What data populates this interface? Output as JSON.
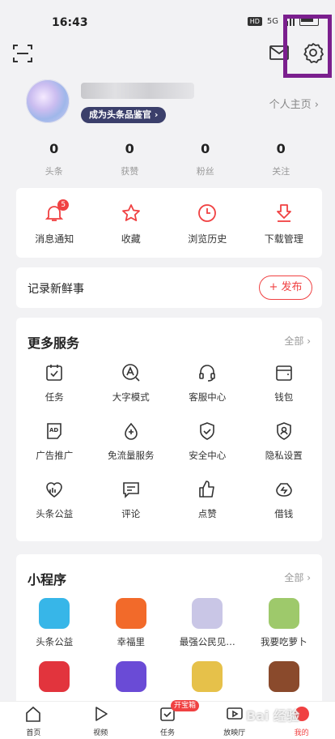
{
  "status": {
    "time": "16:43",
    "network": "5G",
    "hd": "HD"
  },
  "profile": {
    "badge": "成为头条品鉴官 ›",
    "home_link": "个人主页 ›"
  },
  "stats": [
    {
      "num": "0",
      "label": "头条"
    },
    {
      "num": "0",
      "label": "获赞"
    },
    {
      "num": "0",
      "label": "粉丝"
    },
    {
      "num": "0",
      "label": "关注"
    }
  ],
  "quick": [
    {
      "label": "消息通知",
      "icon": "bell-icon",
      "badge": "5"
    },
    {
      "label": "收藏",
      "icon": "star-icon"
    },
    {
      "label": "浏览历史",
      "icon": "clock-icon"
    },
    {
      "label": "下载管理",
      "icon": "download-icon"
    }
  ],
  "post": {
    "title": "记录新鲜事",
    "button": "+ 发布"
  },
  "services": {
    "title": "更多服务",
    "all": "全部 ›",
    "items": [
      {
        "label": "任务",
        "icon": "task-icon"
      },
      {
        "label": "大字模式",
        "icon": "big-font-icon"
      },
      {
        "label": "客服中心",
        "icon": "headset-icon"
      },
      {
        "label": "钱包",
        "icon": "wallet-icon"
      },
      {
        "label": "广告推广",
        "icon": "ad-icon"
      },
      {
        "label": "免流量服务",
        "icon": "data-free-icon"
      },
      {
        "label": "安全中心",
        "icon": "shield-icon"
      },
      {
        "label": "隐私设置",
        "icon": "privacy-icon"
      },
      {
        "label": "头条公益",
        "icon": "charity-icon"
      },
      {
        "label": "评论",
        "icon": "comment-icon"
      },
      {
        "label": "点赞",
        "icon": "thumbs-up-icon"
      },
      {
        "label": "借钱",
        "icon": "loan-icon"
      }
    ]
  },
  "mini": {
    "title": "小程序",
    "all": "全部 ›",
    "items": [
      {
        "label": "头条公益",
        "color": "#37b6e8"
      },
      {
        "label": "幸福里",
        "color": "#f26a2a"
      },
      {
        "label": "最强公民见…",
        "color": "#c9c6e6"
      },
      {
        "label": "我要吃萝卜",
        "color": "#9ec96b"
      },
      {
        "label": "",
        "color": "#e2343d"
      },
      {
        "label": "",
        "color": "#6a4bd6"
      },
      {
        "label": "",
        "color": "#e6c14a"
      },
      {
        "label": "",
        "color": "#8a4a2c"
      }
    ]
  },
  "tabs": [
    {
      "label": "首页",
      "icon": "home-icon"
    },
    {
      "label": "视频",
      "icon": "video-icon"
    },
    {
      "label": "任务",
      "icon": "task-tab-icon",
      "badge": "开宝箱"
    },
    {
      "label": "放映厅",
      "icon": "tv-icon"
    },
    {
      "label": "我的",
      "icon": "profile-icon"
    }
  ],
  "watermark": "Bai 经验",
  "colors": {
    "accent": "#f04142",
    "highlight": "#7b1f8e"
  }
}
